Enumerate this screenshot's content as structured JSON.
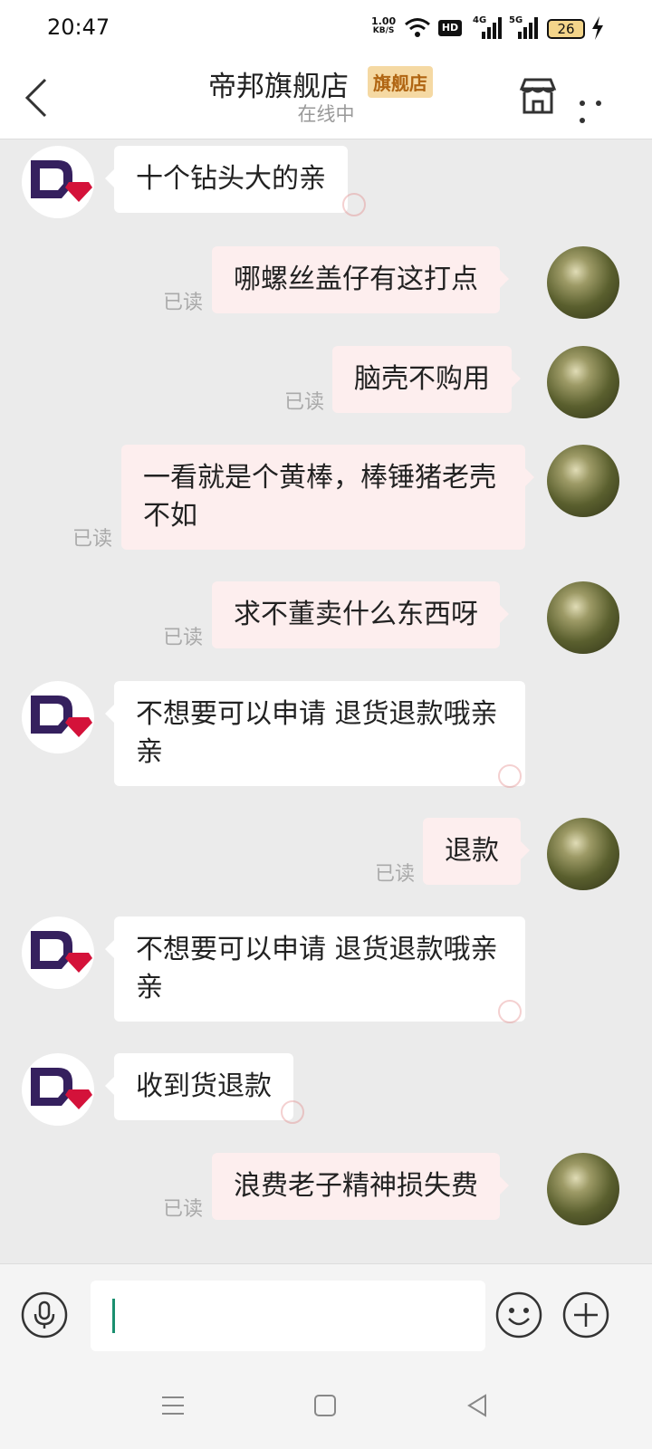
{
  "status_bar": {
    "time": "20:47",
    "net_speed_value": "1.00",
    "net_speed_unit": "KB/S",
    "signal_1": "4G",
    "signal_2": "5G",
    "hd_label": "HD",
    "battery": "26"
  },
  "header": {
    "title": "帝邦旗舰店",
    "badge": "旗舰店",
    "status": "在线中"
  },
  "colors": {
    "outgoing_bubble": "#fdeeee",
    "incoming_bubble": "#ffffff",
    "badge_bg": "#f5d9a3",
    "badge_text": "#b06512",
    "background": "#ebebeb"
  },
  "messages": [
    {
      "side": "in",
      "text": "十个钻头大的亲"
    },
    {
      "side": "out",
      "text": "哪螺丝盖仔有这打点",
      "read": "已读"
    },
    {
      "side": "out",
      "text": "脑壳不购用",
      "read": "已读"
    },
    {
      "side": "out",
      "text": "一看就是个黄棒，棒锤猪老壳不如",
      "read": "已读"
    },
    {
      "side": "out",
      "text": "求不董卖什么东西呀",
      "read": "已读"
    },
    {
      "side": "in",
      "text": "不想要可以申请 退货退款哦亲亲"
    },
    {
      "side": "out",
      "text": "退款",
      "read": "已读"
    },
    {
      "side": "in",
      "text": "不想要可以申请 退货退款哦亲亲"
    },
    {
      "side": "in",
      "text": "收到货退款"
    },
    {
      "side": "out",
      "text": "浪费老子精神损失费",
      "read": "已读"
    }
  ],
  "input": {
    "value": "",
    "icons": [
      "microphone-icon",
      "emoji-icon",
      "plus-icon"
    ]
  },
  "nav": {
    "icons": [
      "menu-icon",
      "home-icon",
      "back-triangle-icon"
    ]
  }
}
